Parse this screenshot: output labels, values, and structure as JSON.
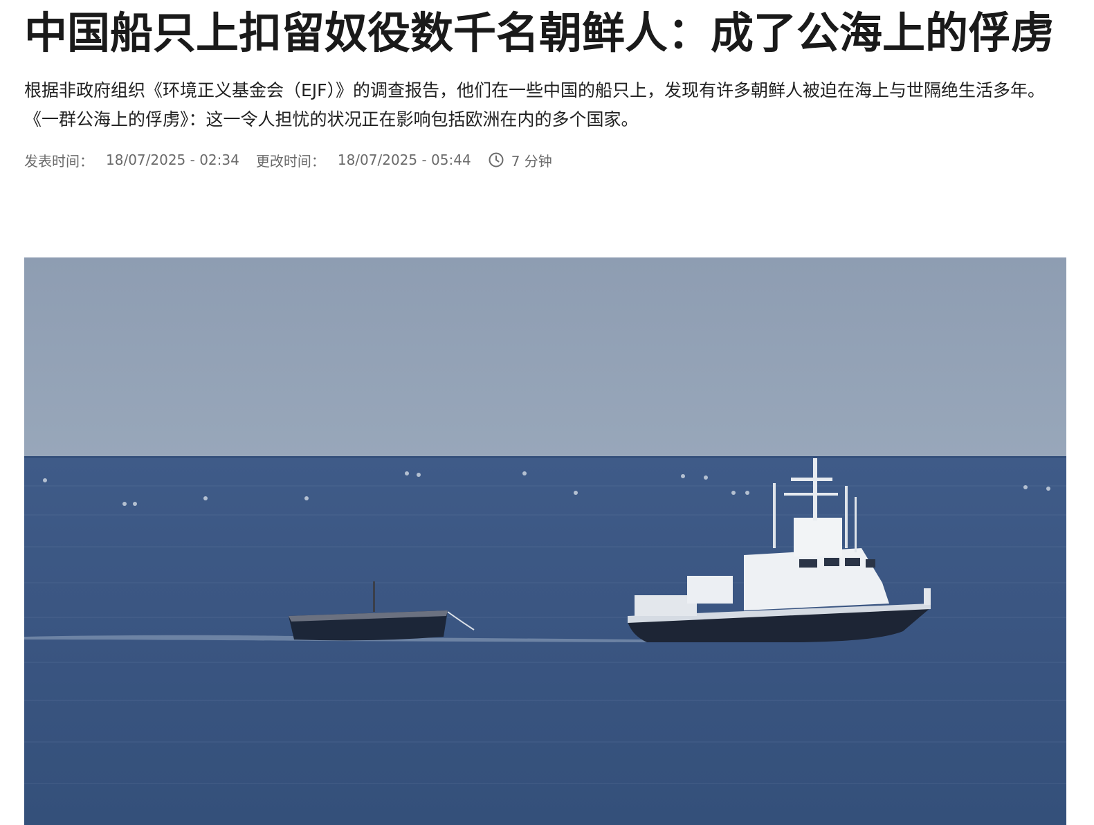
{
  "article": {
    "title": "中国船只上扣留奴役数千名朝鲜人：成了公海上的俘虏",
    "summary": "根据非政府组织《环境正义基金会（EJF）》的调查报告，他们在一些中国的船只上，发现有许多朝鲜人被迫在海上与世隔绝生活多年。《一群公海上的俘虏》：这一令人担忧的状况正在影响包括欧洲在内的多个国家。",
    "meta": {
      "published_label": "发表时间：",
      "published_value": "18/07/2025 - 02:34",
      "updated_label": "更改时间：",
      "updated_value": "18/07/2025 - 05:44",
      "read_time_icon": "clock-icon",
      "read_time": "7 分钟"
    },
    "image": {
      "subject": "ships-at-sea-photo",
      "colors": {
        "sky": "#909fb3",
        "sea": "#3f5a86",
        "sea_dark": "#34507b"
      }
    }
  }
}
